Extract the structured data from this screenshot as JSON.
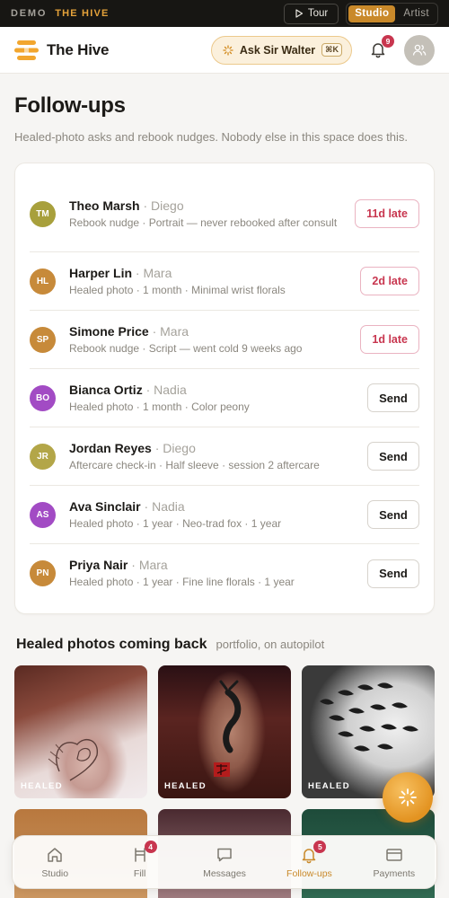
{
  "demo_bar": {
    "label": "DEMO",
    "brand": "THE HIVE",
    "tour_label": "Tour",
    "modes": [
      "Studio",
      "Artist"
    ],
    "active_mode": "Studio"
  },
  "header": {
    "title": "The Hive",
    "ask_label": "Ask Sir Walter",
    "ask_shortcut": "⌘K",
    "notifications_count": "9"
  },
  "page": {
    "title": "Follow-ups",
    "subtitle": "Healed-photo asks and rebook nudges. Nobody else in this space does this."
  },
  "followups": [
    {
      "initials": "TM",
      "name": "Theo Marsh",
      "artist": " · Diego",
      "detail": "Rebook nudge · Portrait — never rebooked after consult",
      "action": "11d late",
      "kind": "late",
      "color": "#a8a03c"
    },
    {
      "initials": "HL",
      "name": "Harper Lin",
      "artist": " · Mara",
      "detail": "Healed photo · 1 month · Minimal wrist florals",
      "action": "2d late",
      "kind": "late",
      "color": "#c78a3a"
    },
    {
      "initials": "SP",
      "name": "Simone Price",
      "artist": " · Mara",
      "detail": "Rebook nudge · Script — went cold 9 weeks ago",
      "action": "1d late",
      "kind": "late",
      "color": "#c78a3a"
    },
    {
      "initials": "BO",
      "name": "Bianca Ortiz",
      "artist": " · Nadia",
      "detail": "Healed photo · 1 month · Color peony",
      "action": "Send",
      "kind": "send",
      "color": "#a24bc4"
    },
    {
      "initials": "JR",
      "name": "Jordan Reyes",
      "artist": " · Diego",
      "detail": "Aftercare check-in · Half sleeve · session 2 aftercare",
      "action": "Send",
      "kind": "send",
      "color": "#b3a648"
    },
    {
      "initials": "AS",
      "name": "Ava Sinclair",
      "artist": " · Nadia",
      "detail": "Healed photo · 1 year · Neo-trad fox · 1 year",
      "action": "Send",
      "kind": "send",
      "color": "#a24bc4"
    },
    {
      "initials": "PN",
      "name": "Priya Nair",
      "artist": " · Mara",
      "detail": "Healed photo · 1 year · Fine line florals · 1 year",
      "action": "Send",
      "kind": "send",
      "color": "#c78a3a"
    }
  ],
  "photos_section": {
    "title": "Healed photos coming back",
    "subtitle": "portfolio, on autopilot",
    "tag": "HEALED"
  },
  "nav": {
    "items": [
      {
        "label": "Studio",
        "icon": "home-icon",
        "badge": ""
      },
      {
        "label": "Fill",
        "icon": "chair-icon",
        "badge": "4"
      },
      {
        "label": "Messages",
        "icon": "message-icon",
        "badge": ""
      },
      {
        "label": "Follow-ups",
        "icon": "bell-icon",
        "badge": "5"
      },
      {
        "label": "Payments",
        "icon": "card-icon",
        "badge": ""
      }
    ],
    "active": "Follow-ups"
  },
  "colors": {
    "accent": "#c9892a",
    "late": "#c8364f",
    "badge": "#c8364f"
  }
}
